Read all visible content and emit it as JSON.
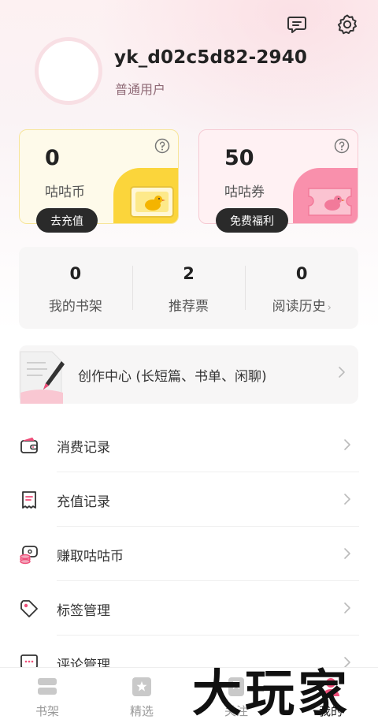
{
  "header": {
    "icons": {
      "message": "message-icon",
      "settings": "gear-icon"
    }
  },
  "profile": {
    "username": "yk_d02c5d82-2940",
    "level": "普通用户"
  },
  "wallet": {
    "coin": {
      "amount": "0",
      "label": "咕咕币",
      "button": "去充值",
      "accent": "#fbd53b"
    },
    "ticket": {
      "amount": "50",
      "label": "咕咕券",
      "button": "免费福利",
      "accent": "#f990ac"
    }
  },
  "stats": [
    {
      "value": "0",
      "label": "我的书架"
    },
    {
      "value": "2",
      "label": "推荐票"
    },
    {
      "value": "0",
      "label": "阅读历史"
    }
  ],
  "creation": {
    "label": "创作中心 (长短篇、书单、闲聊)"
  },
  "menu": [
    {
      "label": "消费记录",
      "icon": "wallet-icon"
    },
    {
      "label": "充值记录",
      "icon": "receipt-icon"
    },
    {
      "label": "赚取咕咕币",
      "icon": "coin-earn-icon"
    },
    {
      "label": "标签管理",
      "icon": "tag-icon"
    },
    {
      "label": "评论管理",
      "icon": "comment-icon"
    }
  ],
  "nav": [
    {
      "label": "书架",
      "icon": "bookshelf-icon"
    },
    {
      "label": "精选",
      "icon": "featured-icon"
    },
    {
      "label": "关注",
      "icon": "follow-icon"
    },
    {
      "label": "我的",
      "icon": "profile-icon",
      "active": true
    }
  ],
  "watermark": {
    "text": "大玩家"
  },
  "colors": {
    "accent_pink": "#ef4f7a",
    "text_dark": "#222222",
    "muted": "#999999"
  }
}
